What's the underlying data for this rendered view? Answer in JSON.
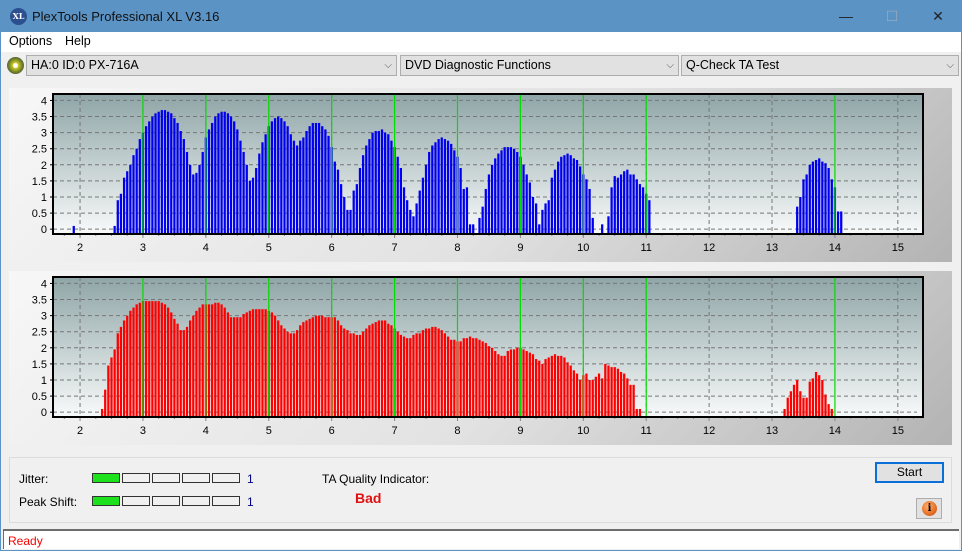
{
  "window": {
    "title": "PlexTools Professional XL V3.16",
    "app_icon_text": "XL",
    "controls": {
      "minimize": "—",
      "maximize": "☐",
      "close": "✕"
    }
  },
  "menu": {
    "items": [
      "Options",
      "Help"
    ]
  },
  "toolbar": {
    "drive_select": "HA:0 ID:0  PX-716A",
    "function_select": "DVD Diagnostic Functions",
    "test_select": "Q-Check TA Test",
    "dropdown_arrow": "⌵"
  },
  "colors": {
    "land_bars": "#0000ee",
    "pit_bars": "#ff0000",
    "marker_lines": "#00dd00",
    "accent": "#0a6fd8",
    "status_text": "#ff0000"
  },
  "chart_data": [
    {
      "type": "bar",
      "name": "top-chart",
      "title": "",
      "xlabel": "",
      "ylabel": "",
      "xlim": [
        1.57,
        15.4
      ],
      "ylim": [
        -0.15,
        4.2
      ],
      "x_ticks": [
        2,
        3,
        4,
        5,
        6,
        7,
        8,
        9,
        10,
        11,
        12,
        13,
        14,
        15
      ],
      "y_ticks": [
        0,
        0.5,
        1,
        1.5,
        2,
        2.5,
        3,
        3.5,
        4
      ],
      "y_tick_labels": [
        "0",
        "0.5",
        "1",
        "1.5",
        "2",
        "2.5",
        "3",
        "3.5",
        "4"
      ],
      "grid": true,
      "marker_lines_x": [
        3,
        4,
        5,
        6,
        7,
        8,
        9,
        10,
        11,
        14
      ],
      "bar_color": "#0000ee",
      "x_start": 1.9,
      "x_step": 0.05,
      "values": [
        0.1,
        0,
        0,
        0,
        0,
        0,
        0,
        0,
        0,
        0,
        0,
        0,
        0,
        0.1,
        0.9,
        1.1,
        1.6,
        1.8,
        2.0,
        2.3,
        2.5,
        2.8,
        3.0,
        3.2,
        3.35,
        3.5,
        3.6,
        3.65,
        3.7,
        3.7,
        3.65,
        3.6,
        3.45,
        3.3,
        3.05,
        2.8,
        2.4,
        2.0,
        1.7,
        1.75,
        2.0,
        2.4,
        2.85,
        3.1,
        3.3,
        3.5,
        3.6,
        3.65,
        3.65,
        3.6,
        3.5,
        3.35,
        3.1,
        2.75,
        2.4,
        2.0,
        1.5,
        1.6,
        1.9,
        2.35,
        2.7,
        2.95,
        3.2,
        3.35,
        3.45,
        3.5,
        3.45,
        3.35,
        3.2,
        2.95,
        2.75,
        2.6,
        2.75,
        2.85,
        3.05,
        3.2,
        3.3,
        3.3,
        3.3,
        3.2,
        3.1,
        2.9,
        2.55,
        2.1,
        1.85,
        1.4,
        1.0,
        0.6,
        0.6,
        1.2,
        1.4,
        1.9,
        2.3,
        2.6,
        2.8,
        3.0,
        3.05,
        3.05,
        3.1,
        3.0,
        2.95,
        2.75,
        2.55,
        2.25,
        1.9,
        1.3,
        0.9,
        0.6,
        0.4,
        0.8,
        1.2,
        1.6,
        2.0,
        2.4,
        2.6,
        2.7,
        2.8,
        2.85,
        2.8,
        2.75,
        2.65,
        2.45,
        2.25,
        1.9,
        1.25,
        1.3,
        0.15,
        0.15,
        0,
        0.35,
        0.7,
        1.25,
        1.7,
        2.0,
        2.2,
        2.35,
        2.45,
        2.55,
        2.55,
        2.55,
        2.5,
        2.4,
        2.25,
        2.0,
        1.7,
        1.45,
        1.0,
        0.8,
        0.15,
        0.6,
        0.8,
        0.9,
        1.6,
        1.85,
        2.1,
        2.25,
        2.3,
        2.35,
        2.3,
        2.2,
        2.15,
        1.95,
        1.7,
        1.55,
        1.25,
        0.35,
        0,
        0,
        0.15,
        0,
        0.4,
        1.3,
        1.65,
        1.6,
        1.7,
        1.8,
        1.85,
        1.7,
        1.7,
        1.55,
        1.4,
        1.3,
        1.1,
        0.9,
        0,
        0,
        0,
        0,
        0,
        0,
        0,
        0,
        0,
        0,
        0,
        0,
        0,
        0,
        0,
        0,
        0,
        0,
        0,
        0,
        0,
        0,
        0,
        0,
        0,
        0,
        0,
        0,
        0,
        0,
        0,
        0,
        0,
        0,
        0,
        0,
        0,
        0,
        0,
        0,
        0,
        0,
        0,
        0,
        0,
        0,
        0.7,
        1.0,
        1.55,
        1.7,
        2.0,
        2.1,
        2.15,
        2.2,
        2.1,
        2.05,
        1.9,
        1.55,
        1.3,
        0.55,
        0.55
      ]
    },
    {
      "type": "bar",
      "name": "bottom-chart",
      "title": "",
      "xlabel": "",
      "ylabel": "",
      "xlim": [
        1.57,
        15.4
      ],
      "ylim": [
        -0.15,
        4.2
      ],
      "x_ticks": [
        2,
        3,
        4,
        5,
        6,
        7,
        8,
        9,
        10,
        11,
        12,
        13,
        14,
        15
      ],
      "y_ticks": [
        0,
        0.5,
        1,
        1.5,
        2,
        2.5,
        3,
        3.5,
        4
      ],
      "y_tick_labels": [
        "0",
        "0.5",
        "1",
        "1.5",
        "2",
        "2.5",
        "3",
        "3.5",
        "4"
      ],
      "grid": true,
      "marker_lines_x": [
        3,
        4,
        5,
        6,
        7,
        8,
        9,
        10,
        11,
        14
      ],
      "bar_color": "#ff0000",
      "x_start": 2.35,
      "x_step": 0.05,
      "values": [
        0.1,
        0.7,
        1.45,
        1.7,
        1.95,
        2.45,
        2.65,
        2.85,
        3.0,
        3.15,
        3.25,
        3.35,
        3.4,
        3.45,
        3.45,
        3.45,
        3.45,
        3.45,
        3.45,
        3.4,
        3.35,
        3.25,
        3.1,
        2.9,
        2.75,
        2.55,
        2.55,
        2.65,
        2.85,
        3.0,
        3.15,
        3.25,
        3.35,
        3.35,
        3.35,
        3.35,
        3.4,
        3.4,
        3.35,
        3.25,
        3.1,
        2.95,
        2.95,
        2.95,
        2.95,
        3.05,
        3.1,
        3.15,
        3.2,
        3.2,
        3.2,
        3.2,
        3.2,
        3.15,
        3.1,
        3.0,
        2.85,
        2.7,
        2.6,
        2.5,
        2.45,
        2.45,
        2.55,
        2.7,
        2.8,
        2.85,
        2.9,
        2.95,
        3.0,
        3.0,
        3.0,
        2.95,
        2.95,
        2.95,
        2.95,
        2.85,
        2.7,
        2.6,
        2.55,
        2.45,
        2.45,
        2.4,
        2.4,
        2.5,
        2.6,
        2.7,
        2.75,
        2.8,
        2.85,
        2.85,
        2.85,
        2.75,
        2.7,
        2.6,
        2.5,
        2.4,
        2.35,
        2.3,
        2.3,
        2.4,
        2.45,
        2.45,
        2.55,
        2.6,
        2.6,
        2.65,
        2.65,
        2.6,
        2.55,
        2.45,
        2.35,
        2.25,
        2.25,
        2.2,
        2.2,
        2.3,
        2.3,
        2.35,
        2.3,
        2.3,
        2.25,
        2.2,
        2.15,
        2.05,
        2.0,
        1.9,
        1.8,
        1.75,
        1.75,
        1.9,
        1.95,
        1.95,
        2.0,
        2.0,
        1.95,
        1.9,
        1.85,
        1.8,
        1.65,
        1.6,
        1.5,
        1.65,
        1.7,
        1.75,
        1.8,
        1.75,
        1.75,
        1.7,
        1.55,
        1.45,
        1.3,
        1.2,
        1.0,
        1.15,
        1.2,
        1.0,
        1.0,
        1.1,
        1.2,
        1.05,
        1.5,
        1.45,
        1.4,
        1.4,
        1.35,
        1.25,
        1.2,
        1.05,
        0.85,
        0.85,
        0.1,
        0.1,
        0,
        0,
        0,
        0,
        0,
        0,
        0,
        0,
        0,
        0,
        0,
        0,
        0,
        0,
        0,
        0,
        0,
        0,
        0,
        0,
        0,
        0,
        0,
        0,
        0,
        0,
        0,
        0,
        0,
        0,
        0,
        0,
        0,
        0,
        0,
        0,
        0,
        0,
        0,
        0,
        0,
        0,
        0,
        0,
        0,
        0.1,
        0.45,
        0.65,
        0.85,
        1.0,
        0.65,
        0.45,
        0.45,
        0.95,
        1.05,
        1.25,
        1.15,
        1.0,
        0.55,
        0.25,
        0.1
      ]
    }
  ],
  "results": {
    "jitter_label": "Jitter:",
    "jitter_level": 1,
    "jitter_max": 5,
    "jitter_value": "1",
    "peak_shift_label": "Peak Shift:",
    "peak_shift_level": 1,
    "peak_shift_max": 5,
    "peak_shift_value": "1",
    "ta_quality_label": "TA Quality Indicator:",
    "ta_quality_value": "Bad"
  },
  "buttons": {
    "start": "Start",
    "info": "i"
  },
  "status": {
    "text": "Ready"
  }
}
